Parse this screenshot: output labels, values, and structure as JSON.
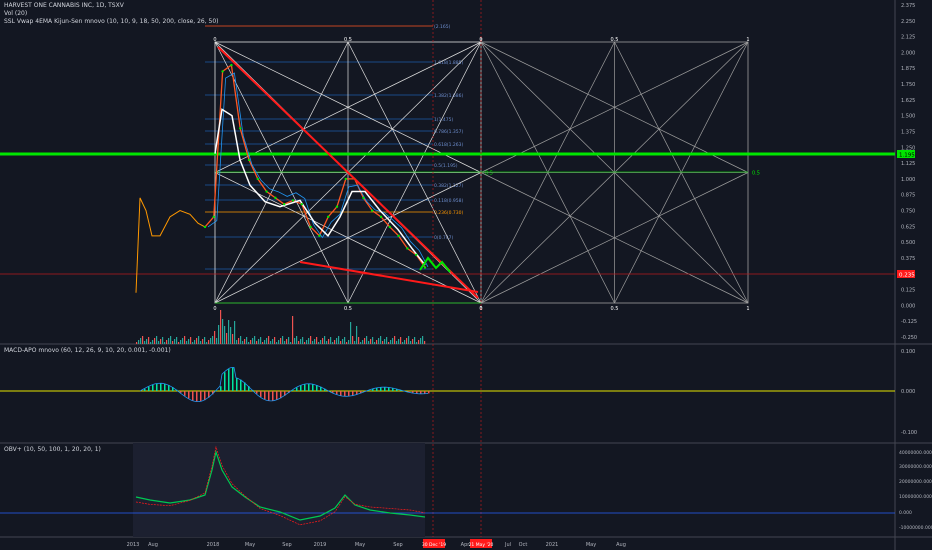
{
  "header": {
    "symbol": "HARVEST ONE CANNABIS INC, 1D, TSXV",
    "vol": "Vol (20)",
    "ssl": "SSL Vwap 4EMA Kijun-Sen mnovo (10, 10, 9, 18, 50, 200, close, 26, 50)"
  },
  "macd_label": "MACD-APO mnovo (60, 12, 26, 9, 10, 20, 0.001, -0.001)",
  "obv_label": "OBV+ (10, 50, 100, 1, 20, 20, 1)",
  "price_axis": {
    "ticks": [
      "2.375",
      "2.250",
      "2.125",
      "2.000",
      "1.875",
      "1.750",
      "1.625",
      "1.500",
      "1.375",
      "1.250",
      "1.125",
      "1.000",
      "0.875",
      "0.750",
      "0.625",
      "0.500",
      "0.375",
      "0.250",
      "0.125",
      "0.000",
      "-0.125",
      "-0.250"
    ],
    "current_price": "0.235",
    "green_line": "1.195"
  },
  "macd_axis": {
    "ticks": [
      "0.100",
      "0.000",
      "-0.100"
    ]
  },
  "obv_axis": {
    "ticks": [
      "40000000.000",
      "30000000.000",
      "20000000.000",
      "10000000.000",
      "0.000",
      "-10000000.000"
    ]
  },
  "time_axis": {
    "ticks": [
      "2013",
      "Aug",
      "2018",
      "May",
      "Sep",
      "2019",
      "May",
      "Sep",
      "Apr",
      "Jul",
      "Oct",
      "2021",
      "May",
      "Aug"
    ],
    "highlight_1": "30 Dec '19",
    "highlight_2": "21 May '20"
  },
  "fib_labels": [
    "(2.165)",
    "1.618(1.885)",
    "1.382(1.686)",
    "1(1.475)",
    "0.786(1.357)",
    "0.618(1.263)",
    "0.5(1.195)",
    "0.382(1.127)",
    "0.236(0.730)",
    "0.118(0.958)",
    "0(0.747)"
  ],
  "gann_labels": {
    "zero": "0",
    "half": "0.5",
    "one": "1"
  },
  "colors": {
    "background": "#131722",
    "grid": "#2a2e39",
    "price": "#ff5722",
    "white_line": "#ffffff",
    "green": "#00e600",
    "red": "#ff1a1a",
    "fib_blue": "#1e5aa8",
    "orange": "#ff9800",
    "obv_green": "#00c853",
    "macd_cyan": "#00e5a0",
    "yellow": "#e6e600"
  },
  "chart_data": {
    "type": "line",
    "x": [
      "2017-11",
      "2017-12",
      "2018-01",
      "2018-02",
      "2018-03",
      "2018-04",
      "2018-05",
      "2018-06",
      "2018-07",
      "2018-08",
      "2018-09",
      "2018-10",
      "2018-11",
      "2018-12",
      "2019-01",
      "2019-02",
      "2019-03",
      "2019-04",
      "2019-05",
      "2019-06",
      "2019-07",
      "2019-08",
      "2019-09",
      "2019-10",
      "2019-11",
      "2019-12"
    ],
    "series": [
      {
        "values": [
          0.62,
          0.7,
          1.85,
          1.9,
          1.4,
          1.15,
          1.0,
          0.9,
          0.85,
          0.8,
          0.83,
          0.8,
          0.62,
          0.55,
          0.7,
          0.78,
          1.0,
          1.0,
          0.85,
          0.75,
          0.7,
          0.62,
          0.55,
          0.45,
          0.4,
          0.3
        ]
      }
    ],
    "ylim": [
      -0.25,
      2.375
    ]
  }
}
